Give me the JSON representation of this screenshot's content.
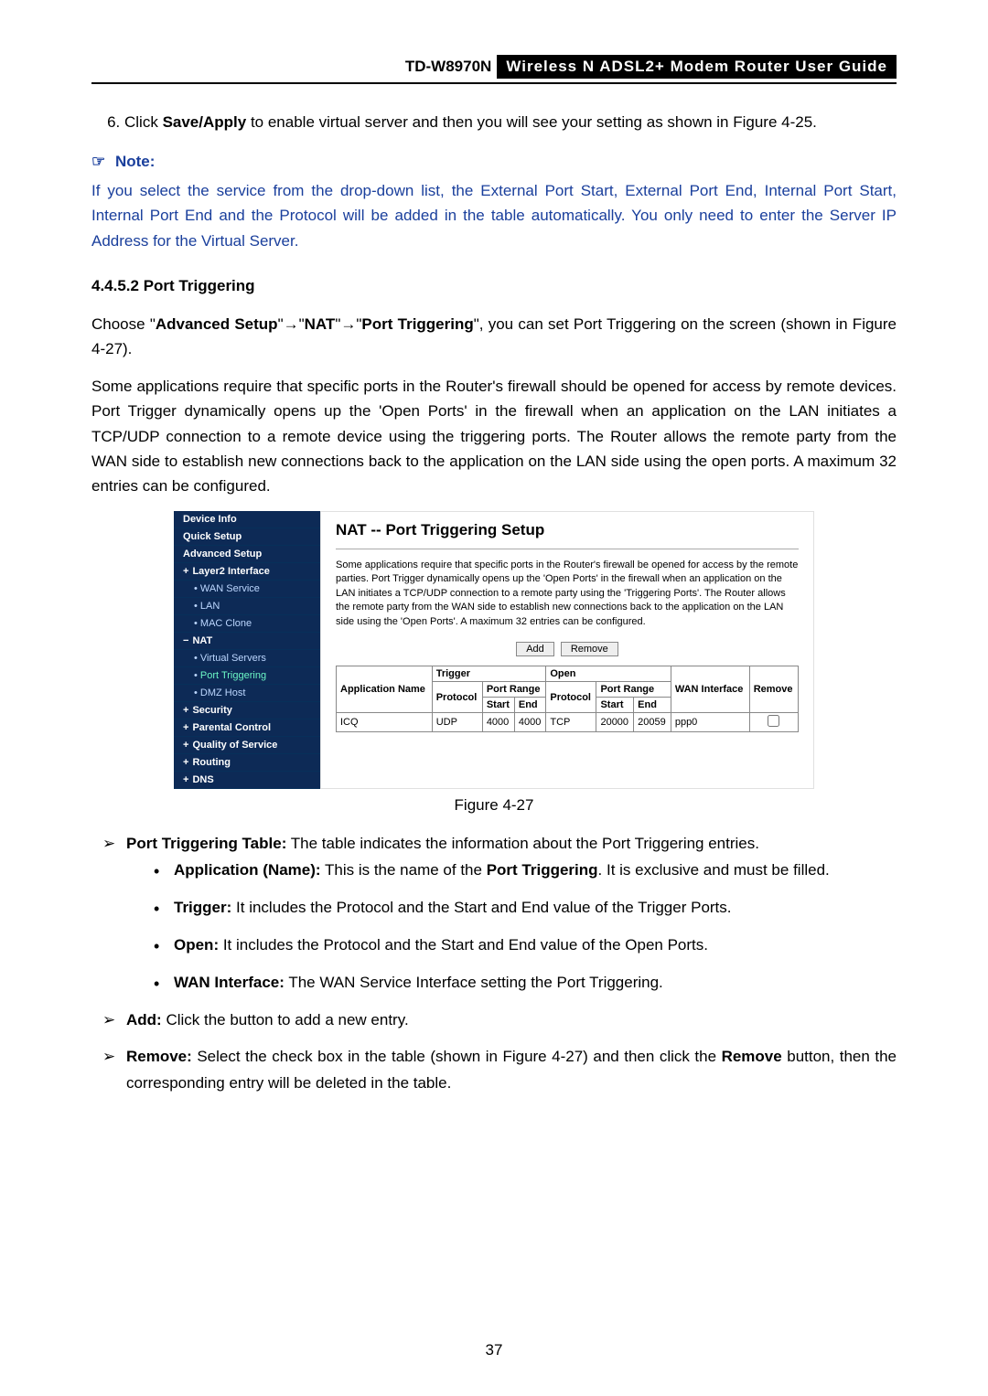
{
  "header": {
    "model": "TD-W8970N",
    "title": "Wireless  N  ADSL2+  Modem  Router  User  Guide"
  },
  "step6": {
    "prefix": "Click ",
    "boldAction": "Save/Apply",
    "suffix": " to enable virtual server and then you will see your setting as shown in Figure 4-25."
  },
  "note": {
    "label": "Note:",
    "body": "If you select the service from the drop-down list, the External Port Start, External Port End, Internal Port Start, Internal Port End and the Protocol will be added in the table automatically. You only need to enter the Server IP Address for the Virtual Server."
  },
  "section": "4.4.5.2    Port Triggering",
  "para1": {
    "t1": "Choose \"",
    "b1": "Advanced Setup",
    "t2": "\"→\"",
    "b2": "NAT",
    "t3": "\"→\"",
    "b3": "Port Triggering",
    "t4": "\", you can set Port Triggering on the screen (shown in Figure 4-27)."
  },
  "para2": "Some applications require that specific ports in the Router's firewall should be opened for access by remote devices. Port Trigger dynamically opens up the 'Open Ports' in the firewall when an application on the LAN initiates a TCP/UDP connection to a remote device using the triggering ports. The Router allows the remote party from the WAN side to establish new connections back to the application on the LAN side using the open ports. A maximum 32 entries can be configured.",
  "sidebar": {
    "items": [
      {
        "label": "Device Info",
        "cls": ""
      },
      {
        "label": "Quick Setup",
        "cls": ""
      },
      {
        "label": "Advanced Setup",
        "cls": ""
      },
      {
        "label": "Layer2 Interface",
        "cls": "plus"
      },
      {
        "label": "WAN Service",
        "cls": "sub"
      },
      {
        "label": "LAN",
        "cls": "sub"
      },
      {
        "label": "MAC Clone",
        "cls": "sub"
      },
      {
        "label": "NAT",
        "cls": "minus"
      },
      {
        "label": "Virtual Servers",
        "cls": "sub"
      },
      {
        "label": "Port Triggering",
        "cls": "sub selected"
      },
      {
        "label": "DMZ Host",
        "cls": "sub"
      },
      {
        "label": "Security",
        "cls": "plus"
      },
      {
        "label": "Parental Control",
        "cls": "plus"
      },
      {
        "label": "Quality of Service",
        "cls": "plus"
      },
      {
        "label": "Routing",
        "cls": "plus"
      },
      {
        "label": "DNS",
        "cls": "plus"
      }
    ]
  },
  "panel": {
    "title": "NAT -- Port Triggering Setup",
    "desc": "Some applications require that specific ports in the Router's firewall be opened for access by the remote parties. Port Trigger dynamically opens up the 'Open Ports' in the firewall when an application on the LAN initiates a TCP/UDP connection to a remote party using the 'Triggering Ports'. The Router allows the remote party from the WAN side to establish new connections back to the application on the LAN side using the 'Open Ports'. A maximum 32 entries can be configured.",
    "addBtn": "Add",
    "removeBtn": "Remove",
    "headers": {
      "appName": "Application Name",
      "trigger": "Trigger",
      "open": "Open",
      "protocol": "Protocol",
      "portRange": "Port Range",
      "start": "Start",
      "end": "End",
      "wan": "WAN Interface",
      "remove": "Remove"
    },
    "row": {
      "app": "ICQ",
      "tProt": "UDP",
      "tStart": "4000",
      "tEnd": "4000",
      "oProt": "TCP",
      "oStart": "20000",
      "oEnd": "20059",
      "wan": "ppp0"
    }
  },
  "figCaption": "Figure 4-27",
  "bullets": {
    "ptTable": {
      "label": "Port Triggering Table:",
      "text": " The table indicates the information about the Port Triggering entries."
    },
    "appName": {
      "label": "Application (Name):",
      "t1": " This is the name of the ",
      "b": "Port Triggering",
      "t2": ". It is exclusive and must be filled."
    },
    "trigger": {
      "label": "Trigger:",
      "text": " It includes the Protocol and the Start and End value of the Trigger Ports."
    },
    "open": {
      "label": "Open:",
      "text": " It includes the Protocol and the Start and End value of the Open Ports."
    },
    "wan": {
      "label": "WAN Interface:",
      "text": " The WAN Service Interface setting the Port Triggering."
    },
    "add": {
      "label": "Add:",
      "text": " Click the button to add a new entry."
    },
    "remove": {
      "label": "Remove:",
      "t1": " Select the check box in the table (shown in Figure 4-27) and then click the ",
      "b": "Remove",
      "t2": " button, then the corresponding entry will be deleted in the table."
    }
  },
  "pageNum": "37"
}
